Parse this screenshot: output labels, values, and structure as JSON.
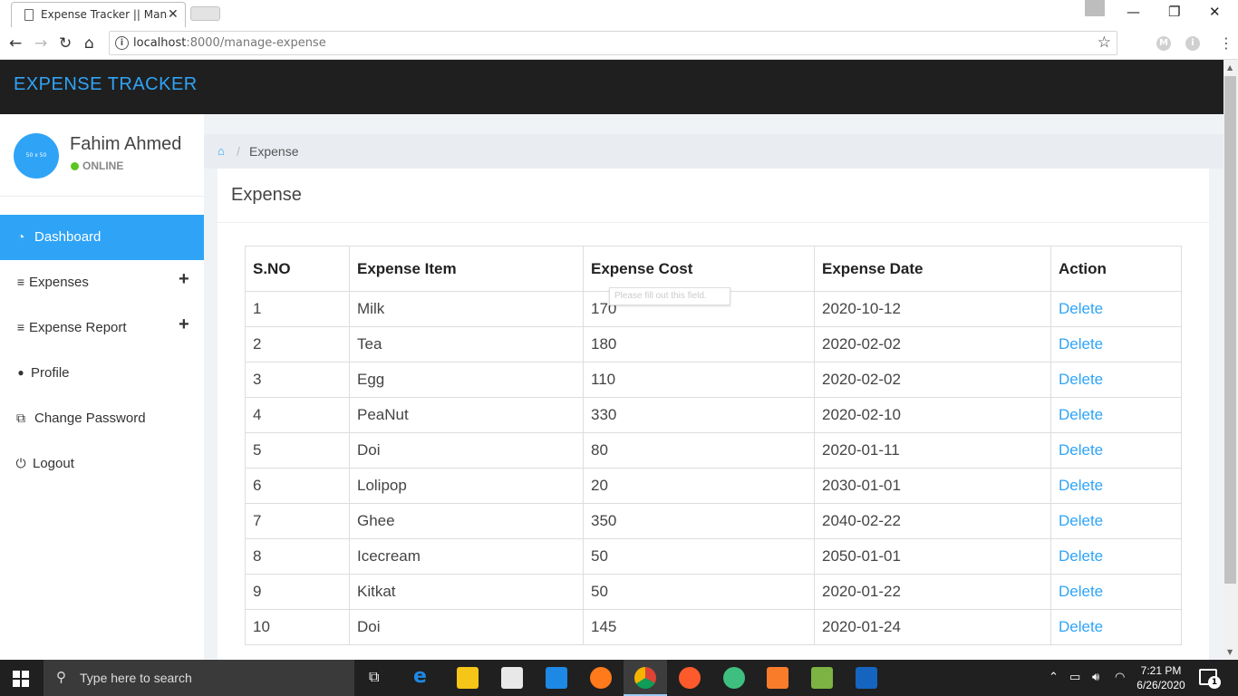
{
  "browser": {
    "tab_title": "Expense Tracker || Manage Expense",
    "url_host": "localhost",
    "url_rest": ":8000/manage-expense"
  },
  "app": {
    "brand": "EXPENSE TRACKER"
  },
  "user": {
    "avatar_text": "50 x 50",
    "name": "Fahim Ahmed",
    "status": "ONLINE"
  },
  "sidebar": {
    "items": [
      {
        "label": "Dashboard",
        "icon": "dashboard-icon",
        "active": true
      },
      {
        "label": "Expenses",
        "icon": "bars-icon",
        "expandable": true
      },
      {
        "label": "Expense Report",
        "icon": "bars-icon",
        "expandable": true
      },
      {
        "label": "Profile",
        "icon": "user-icon"
      },
      {
        "label": "Change Password",
        "icon": "copy-icon"
      },
      {
        "label": "Logout",
        "icon": "power-icon"
      }
    ]
  },
  "breadcrumb": {
    "current": "Expense"
  },
  "card": {
    "title": "Expense"
  },
  "table": {
    "headers": [
      "S.NO",
      "Expense Item",
      "Expense Cost",
      "Expense Date",
      "Action"
    ],
    "rows": [
      [
        "1",
        "Milk",
        "170",
        "2020-10-12",
        "Delete"
      ],
      [
        "2",
        "Tea",
        "180",
        "2020-02-02",
        "Delete"
      ],
      [
        "3",
        "Egg",
        "110",
        "2020-02-02",
        "Delete"
      ],
      [
        "4",
        "PeaNut",
        "330",
        "2020-02-10",
        "Delete"
      ],
      [
        "5",
        "Doi",
        "80",
        "2020-01-11",
        "Delete"
      ],
      [
        "6",
        "Lolipop",
        "20",
        "2030-01-01",
        "Delete"
      ],
      [
        "7",
        "Ghee",
        "350",
        "2040-02-22",
        "Delete"
      ],
      [
        "8",
        "Icecream",
        "50",
        "2050-01-01",
        "Delete"
      ],
      [
        "9",
        "Kitkat",
        "50",
        "2020-01-22",
        "Delete"
      ],
      [
        "10",
        "Doi",
        "145",
        "2020-01-24",
        "Delete"
      ]
    ]
  },
  "tooltip": "Please fill out this field.",
  "taskbar": {
    "search_placeholder": "Type here to search",
    "time": "7:21 PM",
    "date": "6/26/2020",
    "notifications": "1"
  }
}
